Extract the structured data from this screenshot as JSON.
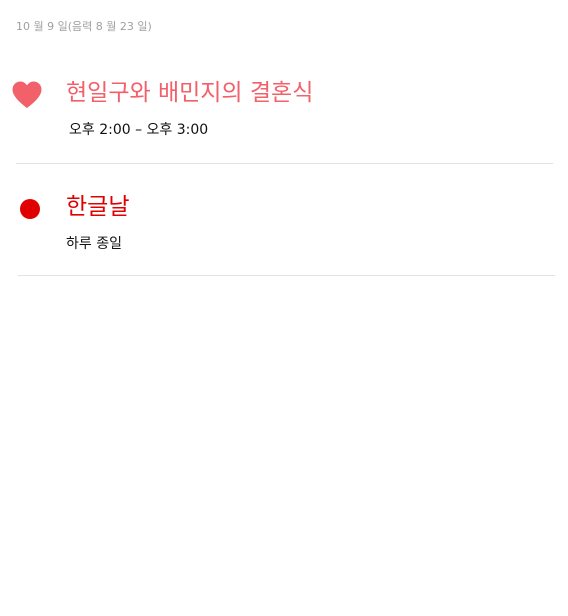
{
  "header": {
    "date_label": "10 월 9 일(음력 8 월 23 일)"
  },
  "events": [
    {
      "title": "현일구와 배민지의 결혼식",
      "time": "오후 2:00 – 오후 3:00",
      "icon": "heart-icon",
      "color": "#f2606a"
    },
    {
      "title": "한글날",
      "time": "하루 종일",
      "icon": "red-dot-icon",
      "color": "#e00000"
    }
  ]
}
